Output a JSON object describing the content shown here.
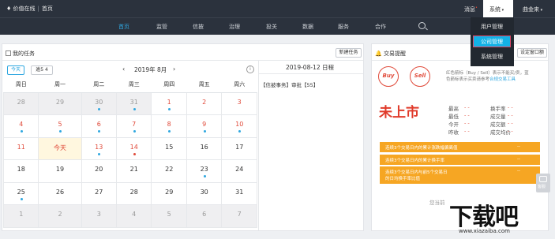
{
  "topbar": {
    "logo": "价值在线",
    "home": "首页",
    "message": "消息",
    "system_menu": "系统",
    "user": "曲金来"
  },
  "nav": [
    "首页",
    "监管",
    "信披",
    "治理",
    "投关",
    "数据",
    "服务",
    "合作"
  ],
  "dropdown": [
    "用户管理",
    "公司管理",
    "系统管理"
  ],
  "tasks": {
    "title": "我的任务",
    "new_task": "新建任务",
    "today_btn": "今天",
    "overdue_btn": "逾5 4",
    "month": "2019年 8月",
    "weekdays": [
      "周日",
      "周一",
      "周二",
      "周三",
      "周四",
      "周五",
      "周六"
    ],
    "weeks": [
      [
        {
          "d": "28",
          "t": "grey"
        },
        {
          "d": "29",
          "t": "grey"
        },
        {
          "d": "30",
          "t": "grey",
          "dot": "b"
        },
        {
          "d": "31",
          "t": "grey",
          "dot": "b"
        },
        {
          "d": "1",
          "dot": "b",
          "red": true
        },
        {
          "d": "2",
          "red": true
        },
        {
          "d": "3",
          "red": true
        }
      ],
      [
        {
          "d": "4",
          "dot": "b",
          "red": true
        },
        {
          "d": "5",
          "dot": "b",
          "red": true
        },
        {
          "d": "6",
          "dot": "b",
          "red": true
        },
        {
          "d": "7",
          "dot": "b",
          "red": true
        },
        {
          "d": "8",
          "dot": "b",
          "red": true
        },
        {
          "d": "9",
          "dot": "b",
          "red": true
        },
        {
          "d": "10",
          "dot": "b",
          "red": true
        }
      ],
      [
        {
          "d": "11",
          "red": true
        },
        {
          "d": "今天",
          "t": "today",
          "red": true
        },
        {
          "d": "13",
          "dot": "b",
          "red": true
        },
        {
          "d": "14",
          "dot": "r",
          "red": true
        },
        {
          "d": "15"
        },
        {
          "d": "16"
        },
        {
          "d": "17"
        }
      ],
      [
        {
          "d": "18"
        },
        {
          "d": "19"
        },
        {
          "d": "20"
        },
        {
          "d": "21"
        },
        {
          "d": "22"
        },
        {
          "d": "23",
          "dot": "b"
        },
        {
          "d": "24"
        }
      ],
      [
        {
          "d": "25",
          "dot": "b"
        },
        {
          "d": "26"
        },
        {
          "d": "27"
        },
        {
          "d": "28"
        },
        {
          "d": "29"
        },
        {
          "d": "30"
        },
        {
          "d": "31"
        }
      ],
      [
        {
          "d": "1",
          "t": "grey"
        },
        {
          "d": "2",
          "t": "grey"
        },
        {
          "d": "3",
          "t": "grey"
        },
        {
          "d": "4",
          "t": "grey"
        },
        {
          "d": "5",
          "t": "grey"
        },
        {
          "d": "6",
          "t": "grey"
        },
        {
          "d": "7",
          "t": "grey"
        }
      ]
    ],
    "schedule_date": "2019-08-12 日程",
    "schedule_item": "【信披事务】审批【55】"
  },
  "trade": {
    "title": "交易提醒",
    "settings_btn": "设定窗口额",
    "buy_label": "Buy",
    "sell_label": "Sell",
    "desc_line1": "红色箭标（Buy / Sell）表示不能买/卖，蓝",
    "desc_line2": "色箭标表示买卖请参考",
    "desc_link": "合规交易工具",
    "status": "未上市",
    "stats": [
      {
        "label": "最高",
        "value": "- -"
      },
      {
        "label": "换手率",
        "value": "- -"
      },
      {
        "label": "最低",
        "value": "- -"
      },
      {
        "label": "成交量",
        "value": "- -"
      },
      {
        "label": "今开",
        "value": "- -"
      },
      {
        "label": "成交额",
        "value": "- -"
      },
      {
        "label": "昨收",
        "value": "- -"
      },
      {
        "label": "成交均价",
        "value": "- -"
      }
    ],
    "rows": [
      {
        "label": "连续3个交易日内的累计涨跌幅偏离值",
        "value": "--"
      },
      {
        "label": "连续3个交易日内的累计换手率",
        "value": "--"
      },
      {
        "label": "连续3个交易日内与前5个交易日",
        "value": "--"
      },
      {
        "label": "的日均换手率比值",
        "value": ""
      }
    ],
    "footer": "您当前"
  },
  "side_widget": "客服",
  "watermark": "下载吧",
  "watermark_url": "www.xiazaiba.com",
  "colors": {
    "accent": "#2fa7e0",
    "red": "#e04a3a",
    "orange": "#f6a623",
    "nav_bg": "#2b323d"
  }
}
